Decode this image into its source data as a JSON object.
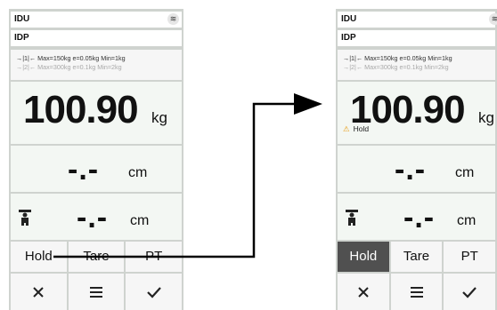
{
  "left": {
    "title1": "IDU",
    "title2": "IDP",
    "range1": "→|1|← Max=150kg e=0.05kg Min=1kg",
    "range2": "→|2|← Max=300kg e=0.1kg Min=2kg",
    "weight": "100.90",
    "weight_unit": "kg",
    "length_value": "-.-",
    "length_unit": "cm",
    "height_value": "-.-",
    "height_unit": "cm",
    "buttons": {
      "hold": "Hold",
      "tare": "Tare",
      "pt": "PT"
    }
  },
  "right": {
    "title1": "IDU",
    "title2": "IDP",
    "range1": "→|1|← Max=150kg e=0.05kg Min=1kg",
    "range2": "→|2|← Max=300kg e=0.1kg Min=2kg",
    "weight": "100.90",
    "weight_unit": "kg",
    "hold_warning": "Hold",
    "length_value": "-.-",
    "length_unit": "cm",
    "height_value": "-.-",
    "height_unit": "cm",
    "buttons": {
      "hold": "Hold",
      "tare": "Tare",
      "pt": "PT"
    },
    "active_button": "Hold"
  },
  "icons": [
    "wifi-icon",
    "warning-icon",
    "person-height-icon",
    "close-icon",
    "menu-icon",
    "check-icon"
  ],
  "colors": {
    "active_button": "#505050",
    "warning": "#e8a020",
    "panel": "#f3f7f3"
  }
}
